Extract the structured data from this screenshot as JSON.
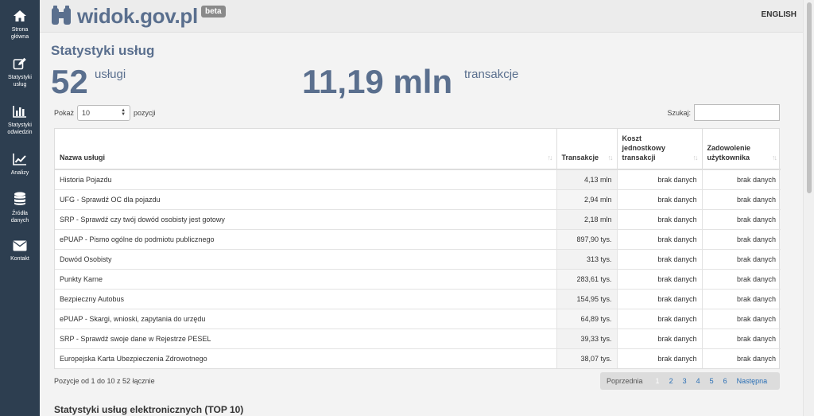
{
  "sidebar": {
    "items": [
      {
        "label": "Strona\ngłówna",
        "icon": "home-icon"
      },
      {
        "label": "Statystyki\nusług",
        "icon": "edit-icon"
      },
      {
        "label": "Statystyki\nodwiedzin",
        "icon": "bar-chart-icon"
      },
      {
        "label": "Analizy",
        "icon": "line-chart-icon"
      },
      {
        "label": "Źródła\ndanych",
        "icon": "database-icon"
      },
      {
        "label": "Kontakt",
        "icon": "envelope-icon"
      }
    ]
  },
  "header": {
    "logo": "widok.gov.pl",
    "badge": "beta",
    "language": "ENGLISH"
  },
  "main": {
    "title": "Statystyki usług",
    "services_count": "52",
    "services_label": "usługi",
    "transactions_count": "11,19 mln",
    "transactions_label": "transakcje",
    "show_label": "Pokaż",
    "show_value": "10",
    "show_suffix": "pozycji",
    "search_label": "Szukaj:",
    "search_value": "",
    "info": "Pozycje od 1 do 10 z 52 łącznie",
    "section_title": "Statystyki usług elektronicznych (TOP 10)"
  },
  "table": {
    "headers": [
      "Nazwa usługi",
      "Transakcje",
      "Koszt jednostkowy transakcji",
      "Zadowolenie użytkownika"
    ],
    "rows": [
      [
        "Historia Pojazdu",
        "4,13 mln",
        "brak danych",
        "brak danych"
      ],
      [
        "UFG - Sprawdź OC dla pojazdu",
        "2,94 mln",
        "brak danych",
        "brak danych"
      ],
      [
        "SRP - Sprawdź czy twój dowód osobisty jest gotowy",
        "2,18 mln",
        "brak danych",
        "brak danych"
      ],
      [
        "ePUAP - Pismo ogólne do podmiotu publicznego",
        "897,90 tys.",
        "brak danych",
        "brak danych"
      ],
      [
        "Dowód Osobisty",
        "313 tys.",
        "brak danych",
        "brak danych"
      ],
      [
        "Punkty Karne",
        "283,61 tys.",
        "brak danych",
        "brak danych"
      ],
      [
        "Bezpieczny Autobus",
        "154,95 tys.",
        "brak danych",
        "brak danych"
      ],
      [
        "ePUAP - Skargi, wnioski, zapytania do urzędu",
        "64,89 tys.",
        "brak danych",
        "brak danych"
      ],
      [
        "SRP - Sprawdź swoje dane w Rejestrze PESEL",
        "39,33 tys.",
        "brak danych",
        "brak danych"
      ],
      [
        "Europejska Karta Ubezpieczenia Zdrowotnego",
        "38,07 tys.",
        "brak danych",
        "brak danych"
      ]
    ]
  },
  "pagination": {
    "previous": "Poprzednia",
    "current": "1",
    "pages": [
      "2",
      "3",
      "4",
      "5",
      "6"
    ],
    "next": "Następna"
  },
  "colors": {
    "sidebar": "#2d3e50",
    "accent": "#5a6f8e",
    "link": "#2a6fb5"
  }
}
